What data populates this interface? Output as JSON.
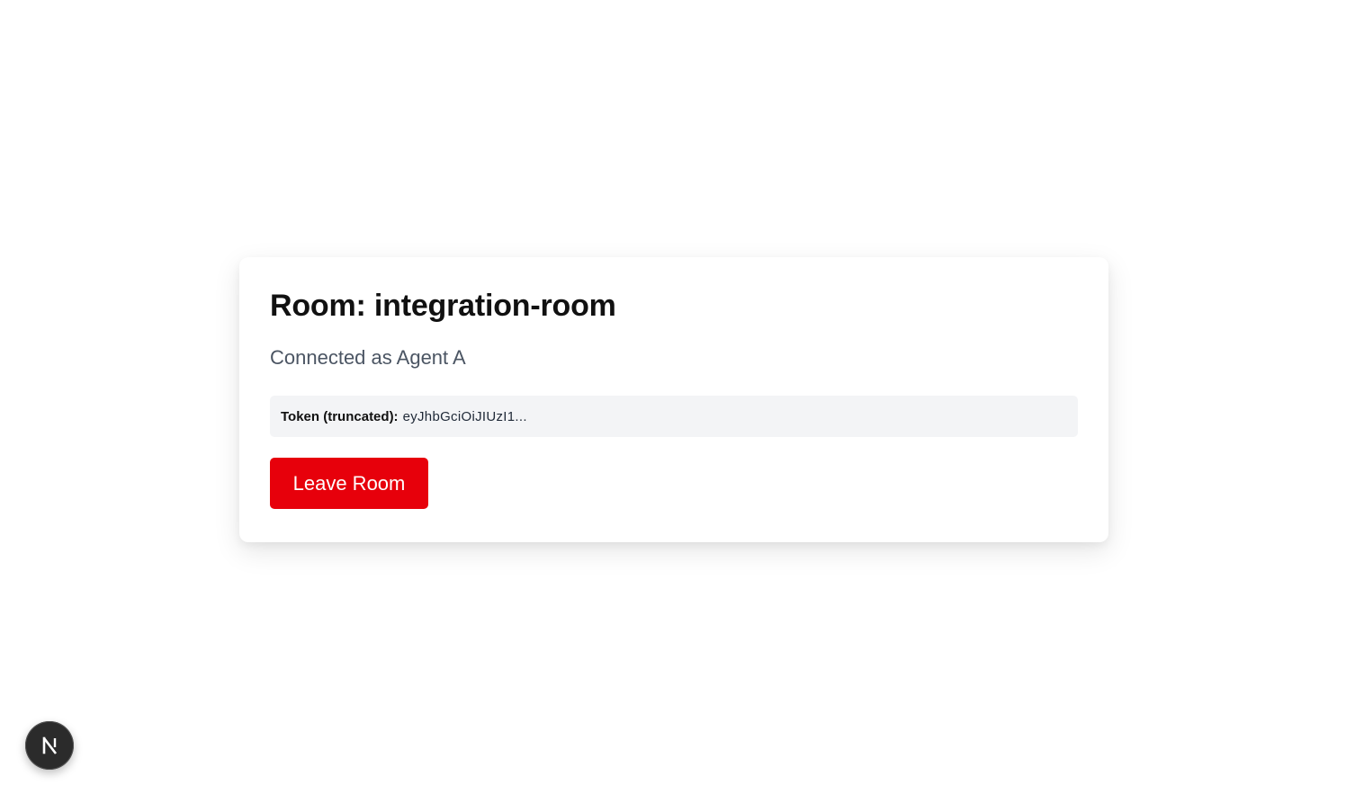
{
  "room": {
    "title_prefix": "Room: ",
    "name": "integration-room",
    "title": "Room: integration-room"
  },
  "connection": {
    "status_text": "Connected as Agent A"
  },
  "token": {
    "label": "Token (truncated):",
    "value": "eyJhbGciOiJIUzI1..."
  },
  "actions": {
    "leave_label": "Leave Room"
  },
  "dev_badge": {
    "icon": "nextjs-logo-icon",
    "letter": "N"
  },
  "colors": {
    "leave_button": "#e7000b",
    "token_background": "#f3f4f6",
    "connected_text": "#4b5563",
    "badge_background": "#2b2b2b"
  }
}
